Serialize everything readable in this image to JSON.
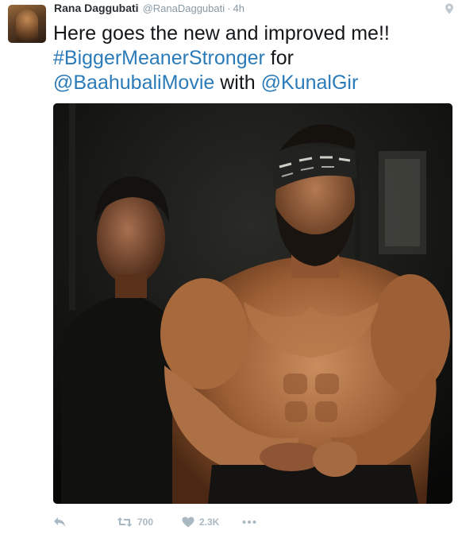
{
  "tweet": {
    "author_name": "Rana Daggubati",
    "handle": "@RanaDaggubati",
    "separator": "·",
    "time": "4h",
    "text": {
      "line1": "Here goes the new and improved me!!",
      "hashtag": "#BiggerMeanerStronger",
      "line2_rest": " for",
      "mention1": "@BaahubaliMovie",
      "line3_mid": " with ",
      "mention2": "@KunalGir"
    },
    "actions": {
      "retweet_count": "700",
      "like_count": "2.3K"
    }
  },
  "icons": {
    "location": "location-pin-icon",
    "reply": "reply-icon",
    "retweet": "retweet-icon",
    "like": "heart-icon",
    "more": "more-dots-icon"
  },
  "colors": {
    "link": "#2b7bb9",
    "muted": "#8899a6",
    "action_icon": "#aab8c2",
    "text": "#14171a"
  }
}
